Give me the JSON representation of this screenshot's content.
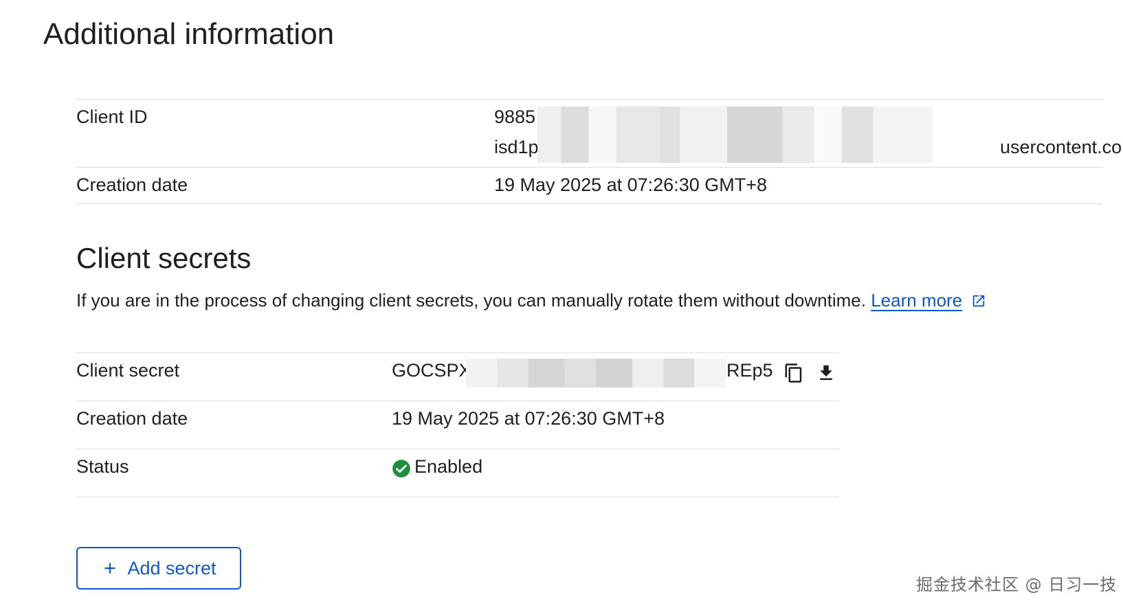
{
  "page": {
    "title": "Additional information"
  },
  "info": {
    "client_id_label": "Client ID",
    "client_id_line1_visible": "9885",
    "client_id_line2_visible_start": "isd1p",
    "client_id_line2_visible_end": "usercontent.com",
    "creation_date_label": "Creation date",
    "creation_date_value": "19 May 2025 at 07:26:30 GMT+8"
  },
  "secrets": {
    "title": "Client secrets",
    "description": "If you are in the process of changing client secrets, you can manually rotate them without downtime.",
    "learn_more": "Learn more",
    "rows": {
      "client_secret_label": "Client secret",
      "client_secret_prefix": "GOCSPX",
      "client_secret_suffix": "REp5",
      "creation_date_label": "Creation date",
      "creation_date_value": "19 May 2025 at 07:26:30 GMT+8",
      "status_label": "Status",
      "status_value": "Enabled"
    },
    "add_button_label": "Add secret"
  },
  "watermark": "掘金技术社区 @ 日习一技",
  "colors": {
    "accent": "#0b57d0",
    "divider": "#dadce0",
    "enabled_green": "#1e8e3e",
    "text": "#1f1f1f"
  },
  "icons": {
    "copy": "copy-icon",
    "download": "download-icon",
    "external_link": "external-link-icon",
    "status_enabled": "check-circle-icon",
    "add": "plus-icon"
  }
}
